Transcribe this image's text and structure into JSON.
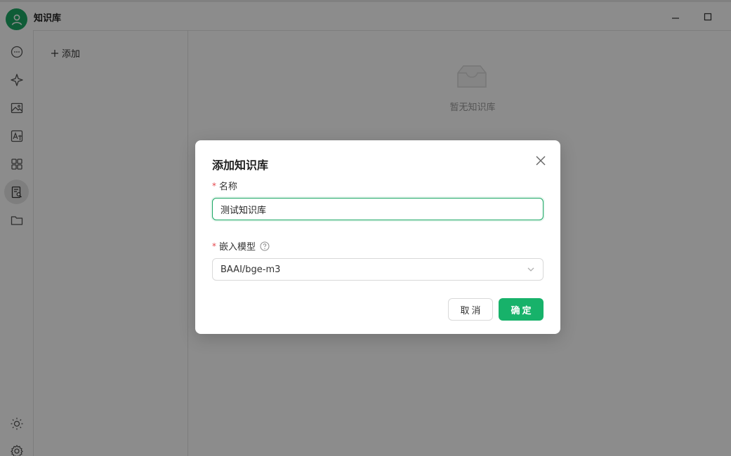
{
  "app": {
    "title": "知识库"
  },
  "list_panel": {
    "add_label": "添加"
  },
  "main": {
    "empty_text": "暂无知识库"
  },
  "modal": {
    "title": "添加知识库",
    "name_label": "名称",
    "name_value": "测试知识库",
    "model_label": "嵌入模型",
    "model_value": "BAAI/bge-m3",
    "cancel_label": "取消",
    "ok_label": "确定"
  },
  "colors": {
    "accent": "#17b26a",
    "avatar": "#1ca865",
    "required": "#e5484d"
  },
  "icons": {
    "rail": [
      "chat-icon",
      "sparkle-icon",
      "image-icon",
      "translate-icon",
      "apps-icon",
      "knowledge-icon",
      "folder-icon",
      "theme-sun-icon",
      "settings-gear-icon"
    ]
  }
}
